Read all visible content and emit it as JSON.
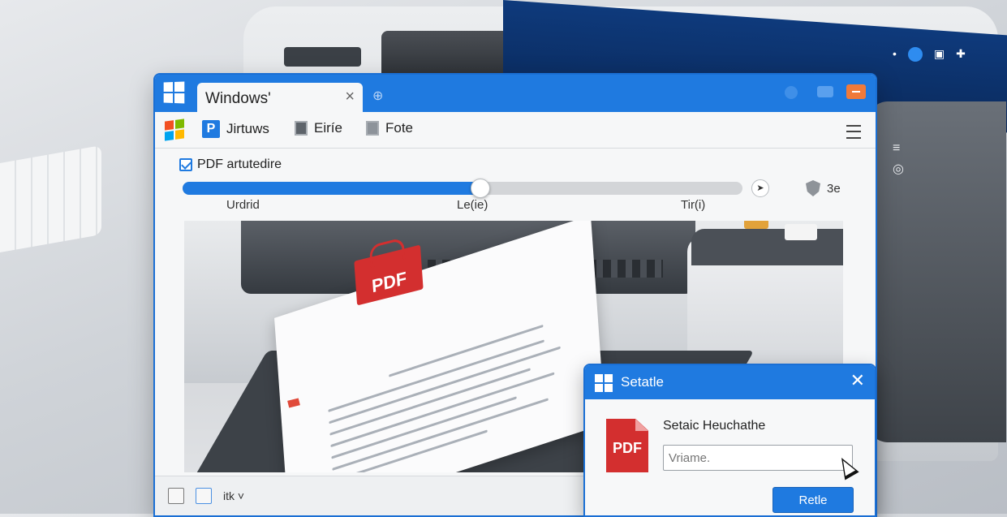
{
  "window": {
    "tab_title": "Windows'",
    "tab_close": "×",
    "new_tab": "⊕"
  },
  "toolbar": {
    "item1": "Jirtuws",
    "item2": "Eiríe",
    "item3": "Fote"
  },
  "options": {
    "checkbox_label": "PDF artutedire",
    "checkbox_checked": true,
    "slider_value_percent": 53,
    "ticks": [
      "Urdrid",
      "Le(ie)",
      "Tir(i)"
    ],
    "side_value": "3e"
  },
  "statusbar": {
    "text": "itk ˅"
  },
  "dialog": {
    "title": "Setatle",
    "close": "✕",
    "pdf_icon_text": "PDF",
    "label": "Setaic Heuchathe",
    "input_placeholder": "Vriame.",
    "button": "Retle"
  },
  "preview": {
    "pdf_badge": "PDF"
  },
  "colors": {
    "accent": "#1f7ae0",
    "pdf_red": "#d32f2f",
    "close_orange": "#f07a3a"
  }
}
